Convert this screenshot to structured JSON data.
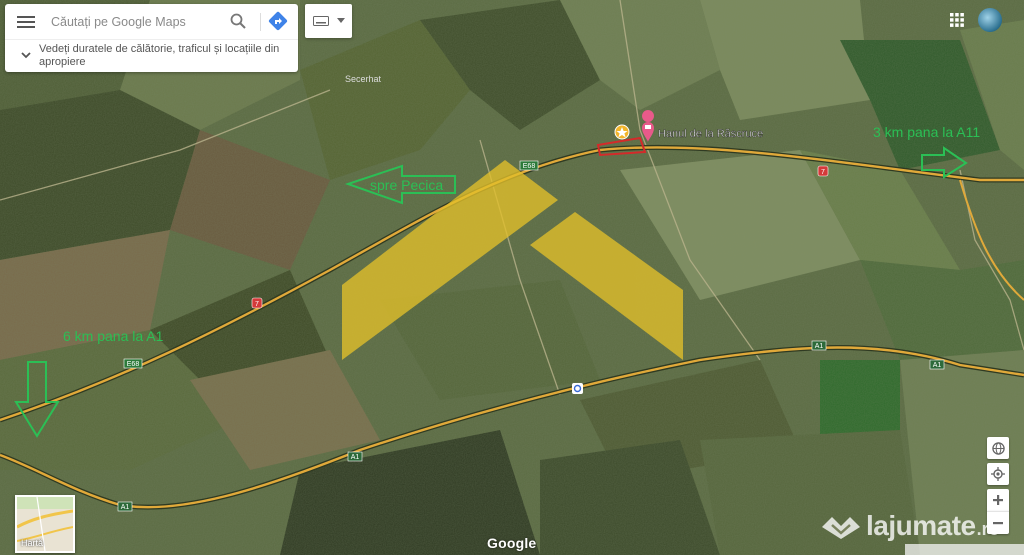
{
  "search": {
    "placeholder": "Căutați pe Google Maps",
    "hint": "Vedeți duratele de călătorie, traficul și locațiile din apropiere"
  },
  "map_labels": {
    "village": "Secerhat",
    "place_name": "Hanul de la Răscruce",
    "route_e68_a": "E68",
    "route_e68_b": "E68",
    "route_7_a": "7",
    "route_7_b": "7",
    "route_a1_a": "A1",
    "route_a1_b": "A1",
    "route_a1_c": "A1",
    "route_a1_d": "A1"
  },
  "annotations": {
    "left_arrow": "spre Pecica",
    "right_arrow": "3 km pana la A11",
    "down_arrow": "6 km pana la A1"
  },
  "controls": {
    "minimap_label": "Hartă"
  },
  "branding": {
    "google": "Google",
    "watermark": "lajumate",
    "watermark_tld": ".ro"
  },
  "colors": {
    "annotation_green": "#2bbf55",
    "overlay_yellow": "#e3c02a",
    "highway": "#e0a93a",
    "parcel_red": "#d42a2a",
    "place_pin": "#e85a8a",
    "star_pin": "#f2b52b"
  }
}
